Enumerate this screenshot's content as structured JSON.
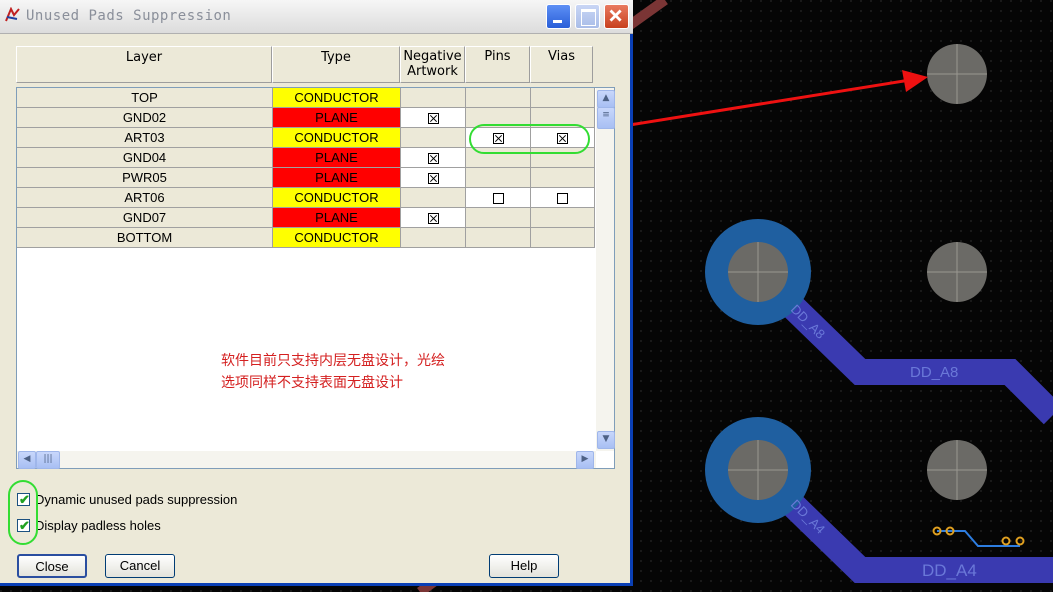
{
  "window": {
    "title": "Unused Pads Suppression"
  },
  "table": {
    "headers": {
      "layer": "Layer",
      "type": "Type",
      "negative_line1": "Negative",
      "negative_line2": "Artwork",
      "pins": "Pins",
      "vias": "Vias"
    },
    "rows": [
      {
        "layer": "TOP",
        "type": "CONDUCTOR",
        "negative": "",
        "pins": "",
        "vias": ""
      },
      {
        "layer": "GND02",
        "type": "PLANE",
        "negative": "checked",
        "pins": "",
        "vias": ""
      },
      {
        "layer": "ART03",
        "type": "CONDUCTOR",
        "negative": "",
        "pins": "checked",
        "vias": "checked"
      },
      {
        "layer": "GND04",
        "type": "PLANE",
        "negative": "checked",
        "pins": "",
        "vias": ""
      },
      {
        "layer": "PWR05",
        "type": "PLANE",
        "negative": "checked",
        "pins": "",
        "vias": ""
      },
      {
        "layer": "ART06",
        "type": "CONDUCTOR",
        "negative": "",
        "pins": "unchecked",
        "vias": "unchecked"
      },
      {
        "layer": "GND07",
        "type": "PLANE",
        "negative": "checked",
        "pins": "",
        "vias": ""
      },
      {
        "layer": "BOTTOM",
        "type": "CONDUCTOR",
        "negative": "",
        "pins": "",
        "vias": ""
      }
    ]
  },
  "annotation": {
    "line1": "软件目前只支持内层无盘设计，光绘",
    "line2": "选项同样不支持表面无盘设计"
  },
  "options": {
    "dynamic_label": "Dynamic unused pads suppression",
    "dynamic_checked": true,
    "padless_label": "Display padless holes",
    "padless_checked": true
  },
  "buttons": {
    "close": "Close",
    "cancel": "Cancel",
    "help": "Help"
  },
  "pcb": {
    "net_a8": "DD_A8",
    "net_a4": "DD_A4",
    "net_a4_label": "DD_A4",
    "net_a4_bottom": "DD_A4"
  },
  "colors": {
    "conductor": "#ffff00",
    "plane": "#ff0000",
    "trace": "#3a3ab0",
    "highlight_ring": "#33dd33",
    "arrow": "#ee1111"
  }
}
